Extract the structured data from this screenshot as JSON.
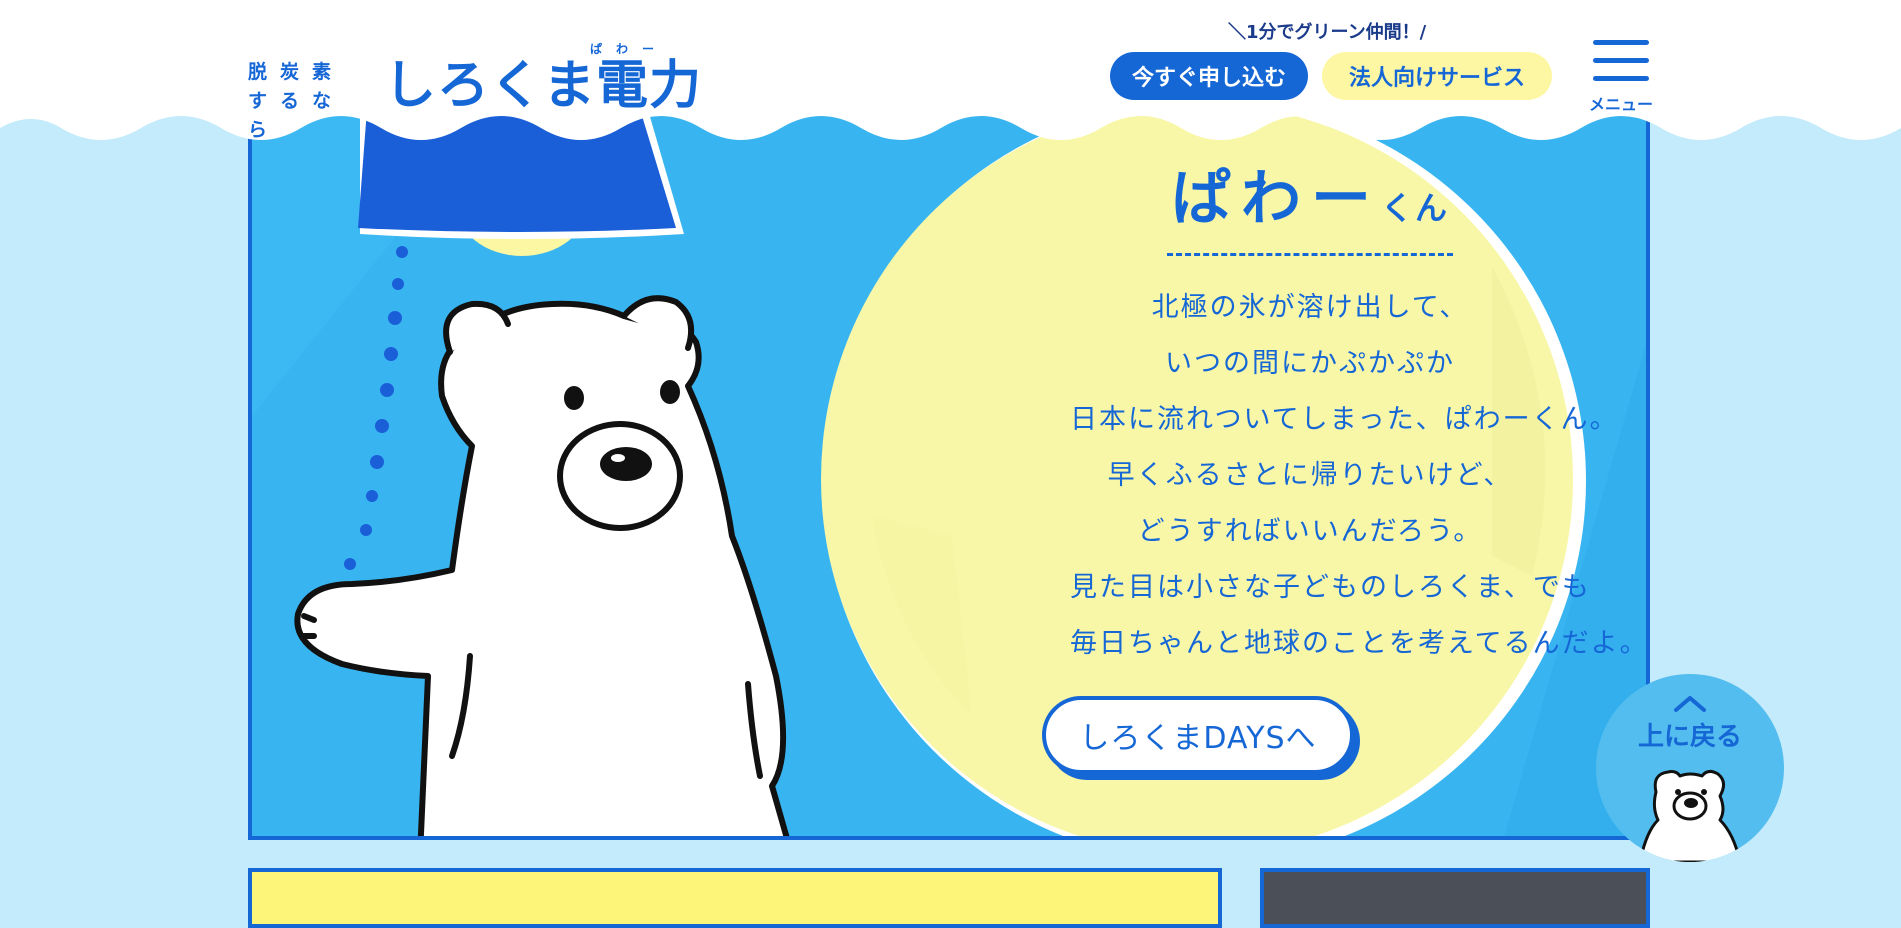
{
  "header": {
    "logo": {
      "tagline_line1": "脱炭素",
      "tagline_line2": "するなら",
      "name": "しろくま電力",
      "ruby": "ぱわー"
    },
    "catchphrase": "＼1分でグリーン仲間！/",
    "apply_button": "今すぐ申し込む",
    "corporate_button": "法人向けサービス",
    "menu_label": "メニュー"
  },
  "hero": {
    "title": "ぱわー",
    "title_suffix": "くん",
    "lines": [
      "北極の氷が溶け出して、",
      "いつの間にかぷかぷか",
      "日本に流れついてしまった、ぱわーくん。",
      "早くふるさとに帰りたいけど、",
      "どうすればいいんだろう。",
      "見た目は小さな子どものしろくま、でも",
      "毎日ちゃんと地球のことを考えてるんだよ。"
    ],
    "cta": "しろくまDAYSへ"
  },
  "back_to_top": {
    "label": "上に戻る"
  },
  "colors": {
    "brand_blue": "#1667d6",
    "sky": "#37b6f2",
    "page_bg": "#c4ebfb",
    "moon": "#f8f7a8",
    "accent_yellow": "#fdf7a4"
  },
  "icons": {
    "menu": "hamburger-icon",
    "back_to_top": "chevron-up-icon",
    "mascot": "polar-bear-icon"
  }
}
